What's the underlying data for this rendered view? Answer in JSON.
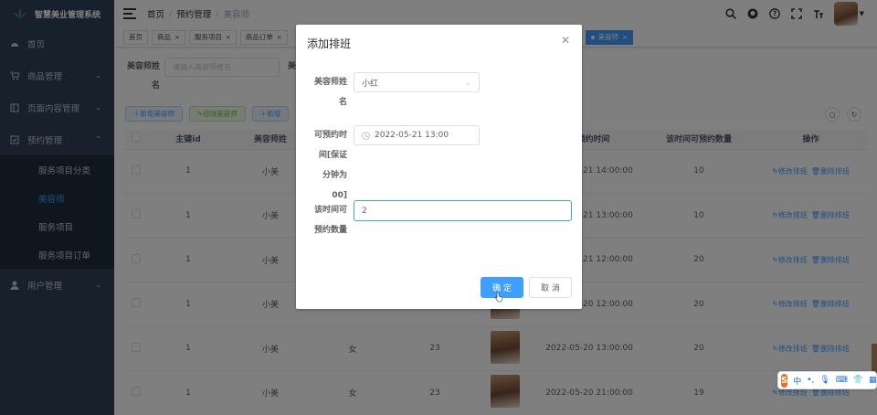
{
  "app": {
    "title": "智慧美业管理系统"
  },
  "sidebar": {
    "items": [
      {
        "label": "首页",
        "icon": "dashboard-icon"
      },
      {
        "label": "商品管理",
        "icon": "cart-icon"
      },
      {
        "label": "页面内容管理",
        "icon": "page-icon"
      },
      {
        "label": "预约管理",
        "icon": "checkbox-icon"
      },
      {
        "label": "用户管理",
        "icon": "user-icon"
      }
    ],
    "submenu": [
      {
        "label": "服务项目分类"
      },
      {
        "label": "美容师"
      },
      {
        "label": "服务项目"
      },
      {
        "label": "服务项目订单"
      }
    ]
  },
  "breadcrumb": [
    "首页",
    "预约管理",
    "美容师"
  ],
  "tags": [
    "首页",
    "商品",
    "服务项目",
    "商品订单",
    "美容师"
  ],
  "search": {
    "label": "美容师姓名",
    "placeholder": "请输入美容师姓名",
    "label2": "美"
  },
  "toolbar": {
    "add_label": "新增美容师",
    "edit_label": "修改美容师",
    "more_label": "新增"
  },
  "table": {
    "headers": [
      "主键id",
      "美容师姓",
      "",
      "",
      "",
      "可预约时间",
      "该时间可预约数量",
      "操作"
    ],
    "rows": [
      {
        "id": "1",
        "name": "小美",
        "gender": "",
        "age": "",
        "time": "2022-05-21 14:00:00",
        "count": "10"
      },
      {
        "id": "1",
        "name": "小美",
        "gender": "",
        "age": "",
        "time": "2022-05-21 13:00:00",
        "count": "10"
      },
      {
        "id": "1",
        "name": "小美",
        "gender": "",
        "age": "",
        "time": "2022-05-21 12:00:00",
        "count": "20"
      },
      {
        "id": "1",
        "name": "小美",
        "gender": "",
        "age": "",
        "time": "2022-05-20 12:00:00",
        "count": "20"
      },
      {
        "id": "1",
        "name": "小美",
        "gender": "女",
        "age": "23",
        "time": "2022-05-20 13:00:00",
        "count": "20"
      },
      {
        "id": "1",
        "name": "小美",
        "gender": "女",
        "age": "23",
        "time": "2022-05-20 21:00:00",
        "count": "19"
      }
    ],
    "edit_label": "修改排班",
    "delete_label": "删除排班"
  },
  "dialog": {
    "title": "添加排班",
    "name_label": "美容师姓名",
    "name_value": "小红",
    "time_label": "可预约时间[保证分钟为00]",
    "time_value": "2022-05-21 13:00",
    "count_label": "该时间可预约数量",
    "count_value": "2",
    "confirm_label": "确 定",
    "cancel_label": "取 消"
  },
  "ime": {
    "logo": "S",
    "mode": "中"
  }
}
